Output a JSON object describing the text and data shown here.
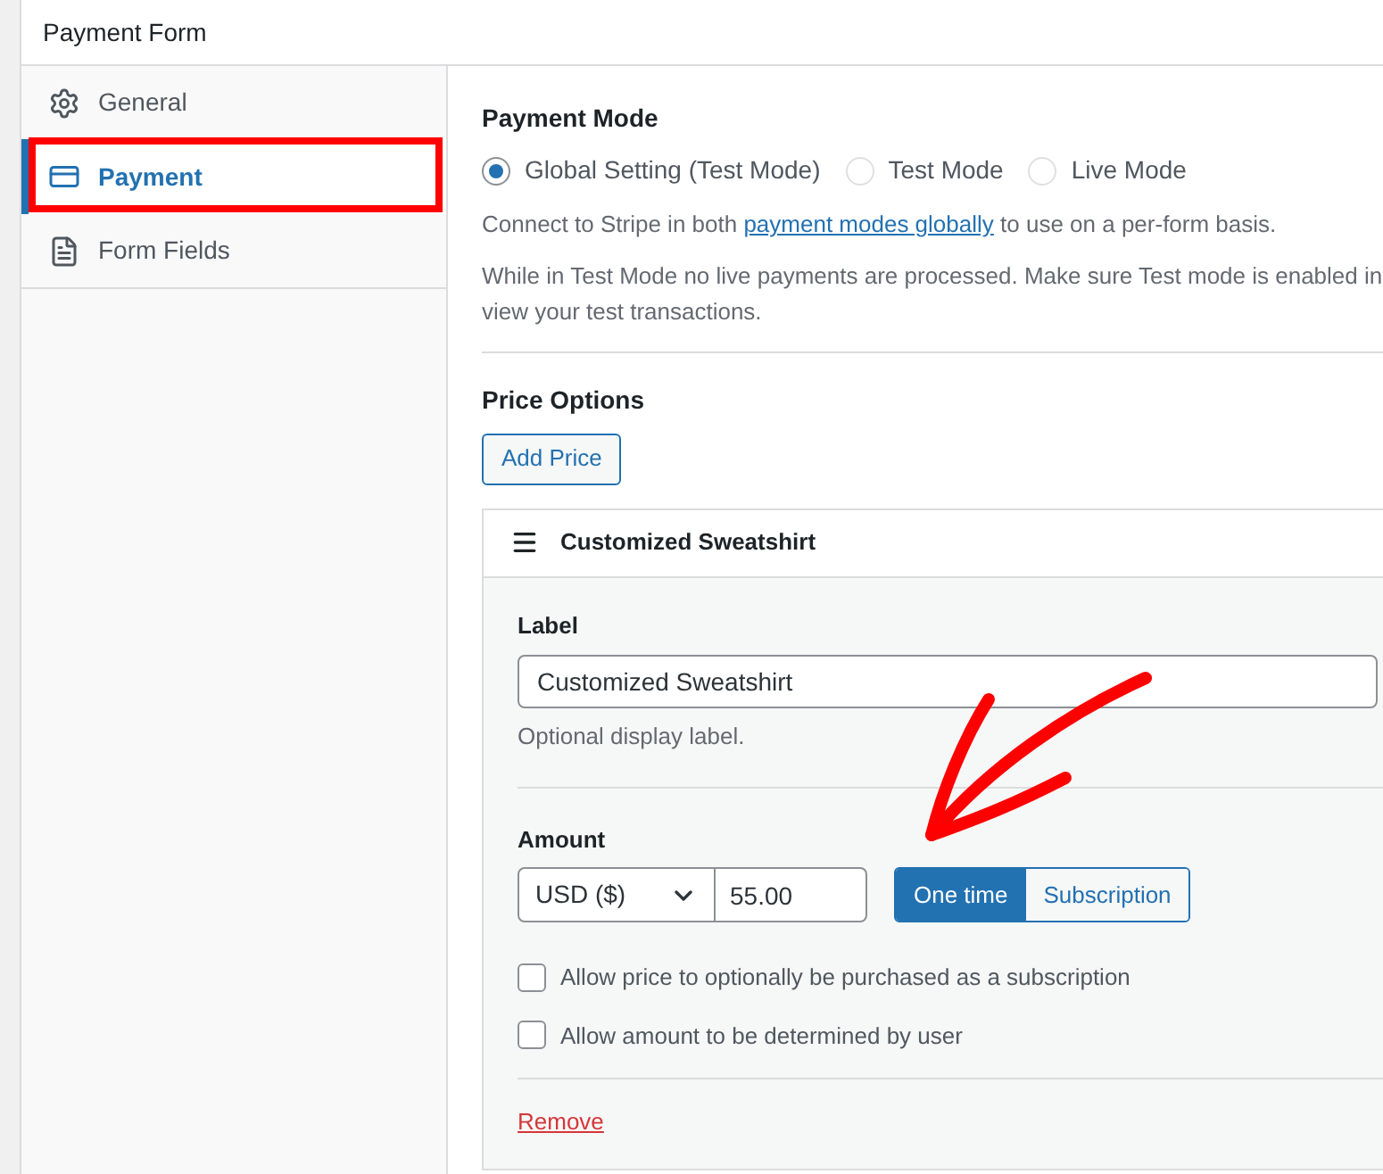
{
  "window": {
    "title": "Payment Form"
  },
  "sidebar": {
    "items": [
      {
        "label": "General",
        "selected": false
      },
      {
        "label": "Payment",
        "selected": true
      },
      {
        "label": "Form Fields",
        "selected": false
      }
    ]
  },
  "payment_mode": {
    "title": "Payment Mode",
    "options": [
      {
        "label": "Global Setting (Test Mode)",
        "selected": true
      },
      {
        "label": "Test Mode",
        "selected": false
      },
      {
        "label": "Live Mode",
        "selected": false
      }
    ],
    "note": {
      "before": "Connect to Stripe in both ",
      "link": "payment modes globally",
      "after": " to use on a per-form basis."
    },
    "warning_lines": [
      "While in Test Mode no live payments are processed. Make sure Test mode is enabled in",
      "view your test transactions."
    ]
  },
  "price_options": {
    "title": "Price Options",
    "add_button": "Add Price",
    "price": {
      "title": "Customized Sweatshirt",
      "label_title": "Label",
      "label_value": "Customized Sweatshirt",
      "label_help": "Optional display label.",
      "amount_title": "Amount",
      "currency": "USD ($)",
      "amount": "55.00",
      "types": [
        {
          "label": "One time",
          "selected": true
        },
        {
          "label": "Subscription",
          "selected": false
        }
      ],
      "options": [
        {
          "label": "Allow price to optionally be purchased as a subscription",
          "checked": false
        },
        {
          "label": "Allow amount to be determined by user",
          "checked": false
        }
      ],
      "remove": "Remove"
    }
  }
}
